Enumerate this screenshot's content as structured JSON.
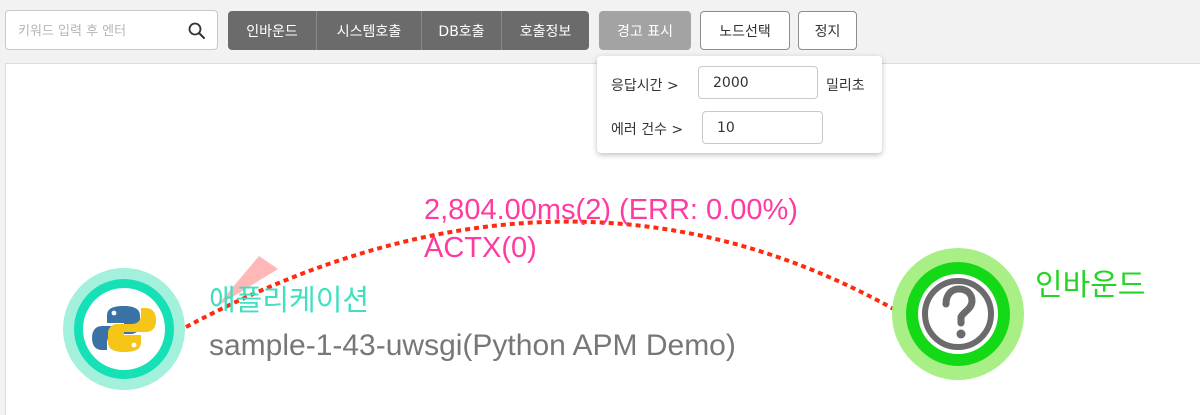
{
  "search": {
    "placeholder": "키워드 입력 후 엔터",
    "value": ""
  },
  "toolbar": {
    "group_buttons": [
      "인바운드",
      "시스템호출",
      "DB호출",
      "호출정보"
    ],
    "warn_label": "경고 표시",
    "node_select_label": "노드선택",
    "stop_label": "정지"
  },
  "alert_popup": {
    "response_time_label": "응답시간  >",
    "response_time_value": "2000",
    "response_time_unit": "밀리초",
    "error_count_label": "에러 건수  >",
    "error_count_value": "10"
  },
  "topology": {
    "edge_label_line1": "2,804.00ms(2) (ERR: 0.00%)",
    "edge_label_line2": "ACTX(0)",
    "app_node": {
      "type_label": "애플리케이션",
      "name": "sample-1-43-uwsgi(Python APM Demo)",
      "icon": "python-logo-icon"
    },
    "inbound_node": {
      "type_label": "인바운드",
      "icon": "question-mark-icon"
    },
    "colors": {
      "edge": "#ff2a0f",
      "edge_label": "#ff3aa0",
      "app_label": "#3fe0c1",
      "app_name": "#777777",
      "inbound_label": "#25d425",
      "app_ring": "#a3f1dc",
      "app_inner_ring": "#16e0b6",
      "inbound_ring": "#a8ef86",
      "inbound_inner_ring": "#14d916"
    }
  }
}
